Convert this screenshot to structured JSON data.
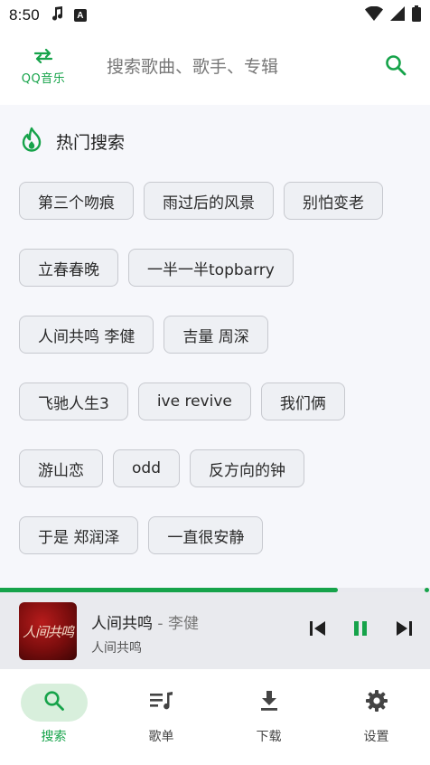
{
  "status_bar": {
    "time": "8:50",
    "icons": [
      "music-note-icon",
      "a-badge-icon",
      "wifi-icon",
      "signal-icon",
      "battery-icon"
    ]
  },
  "header": {
    "logo_text": "QQ音乐",
    "search_placeholder": "搜索歌曲、歌手、专辑"
  },
  "hot_search": {
    "title": "热门搜索",
    "rows": [
      [
        "第三个吻痕",
        "雨过后的风景",
        "别怕变老"
      ],
      [
        "立春春晚",
        "一半一半topbarry"
      ],
      [
        "人间共鸣 李健",
        "吉量 周深"
      ],
      [
        "飞驰人生3",
        "ive revive",
        "我们俩"
      ],
      [
        "游山恋",
        "odd",
        "反方向的钟"
      ],
      [
        "于是 郑润泽",
        "一直很安静"
      ]
    ]
  },
  "player": {
    "progress": 0.785,
    "title": "人间共鸣",
    "separator": " - ",
    "artist": "李健",
    "album": "人间共鸣",
    "cover_text": "人间共鸣"
  },
  "nav": {
    "items": [
      {
        "label": "搜索",
        "icon": "search-icon",
        "active": true
      },
      {
        "label": "歌单",
        "icon": "playlist-icon",
        "active": false
      },
      {
        "label": "下载",
        "icon": "download-icon",
        "active": false
      },
      {
        "label": "设置",
        "icon": "settings-gear-icon",
        "active": false
      }
    ]
  },
  "colors": {
    "accent": "#16a34a",
    "background": "#f6f7fb",
    "chip_border": "#c7c9cf",
    "player_bg": "#e9eaee"
  }
}
